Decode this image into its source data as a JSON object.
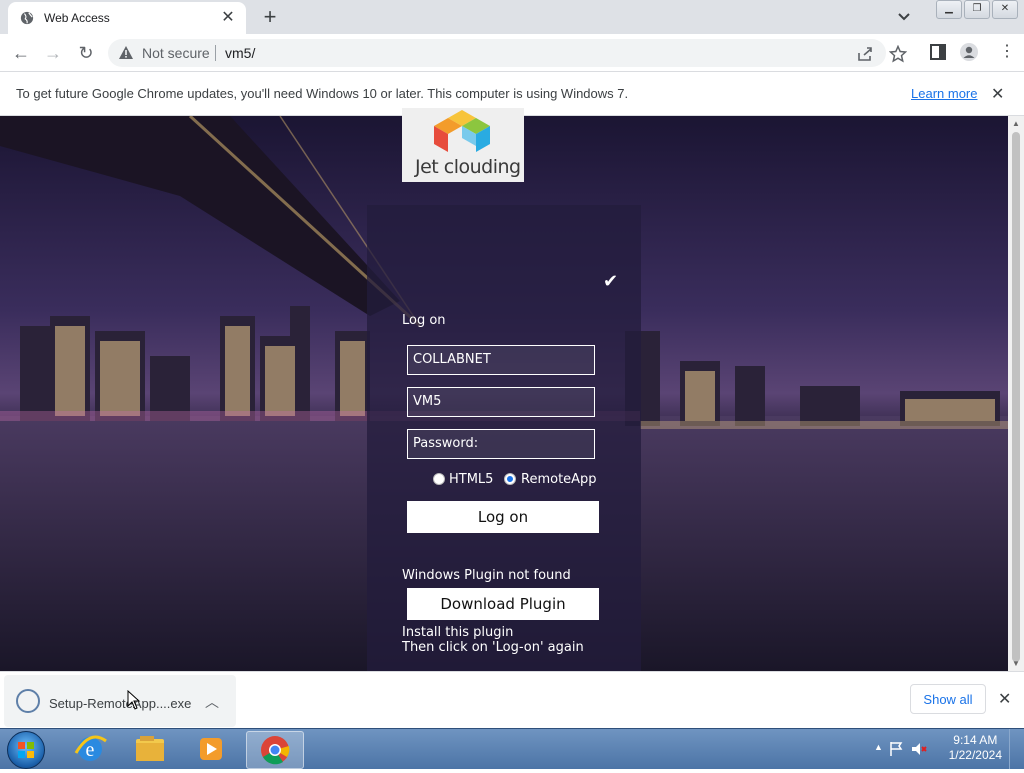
{
  "browser": {
    "tab_title": "Web Access",
    "security_label": "Not secure",
    "url": "vm5/"
  },
  "infobar": {
    "message": "To get future Google Chrome updates, you'll need Windows 10 or later. This computer is using Windows 7.",
    "learn_more": "Learn more"
  },
  "login": {
    "logo_text": "Jet clouding",
    "heading": "Log on",
    "domain_value": "COLLABNET",
    "server_value": "VM5",
    "password_placeholder": "Password:",
    "radio_html5": "HTML5",
    "radio_remoteapp": "RemoteApp",
    "selected_mode": "RemoteApp",
    "logon_button": "Log on",
    "plugin_status": "Windows Plugin not found",
    "download_button": "Download Plugin",
    "install_line1": "Install this plugin",
    "install_line2": "Then click on 'Log-on' again"
  },
  "downloads": {
    "file_name": "Setup-RemoteApp....exe",
    "show_all": "Show all"
  },
  "taskbar": {
    "time": "9:14 AM",
    "date": "1/22/2024"
  },
  "colors": {
    "accent": "#1a73e8",
    "panel": "#231c3c"
  }
}
